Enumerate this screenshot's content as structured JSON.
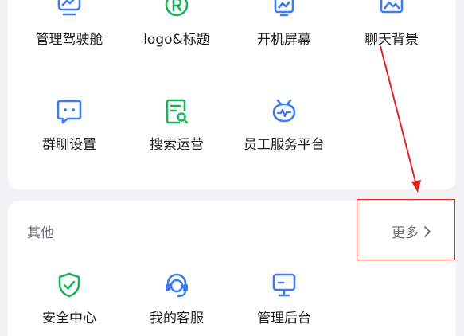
{
  "apps": {
    "row_top": [
      {
        "label": "管理驾驶舱",
        "icon": "dashboard-chart-icon"
      },
      {
        "label": "logo&标题",
        "icon": "registered-mark-icon"
      },
      {
        "label": "开机屏幕",
        "icon": "boot-screen-icon"
      },
      {
        "label": "聊天背景",
        "icon": "chat-background-icon"
      }
    ],
    "row_middle": [
      {
        "label": "群聊设置",
        "icon": "group-chat-icon"
      },
      {
        "label": "搜索运营",
        "icon": "search-document-icon"
      },
      {
        "label": "员工服务平台",
        "icon": "employee-service-icon"
      }
    ]
  },
  "other_section": {
    "title": "其他",
    "more_label": "更多",
    "items": [
      {
        "label": "安全中心",
        "icon": "shield-check-icon"
      },
      {
        "label": "我的客服",
        "icon": "customer-service-headset-icon"
      },
      {
        "label": "管理后台",
        "icon": "admin-monitor-icon"
      }
    ]
  },
  "colors": {
    "blue": "#3d7bf3",
    "green": "#1bb35a",
    "annotation": "#e52420"
  }
}
